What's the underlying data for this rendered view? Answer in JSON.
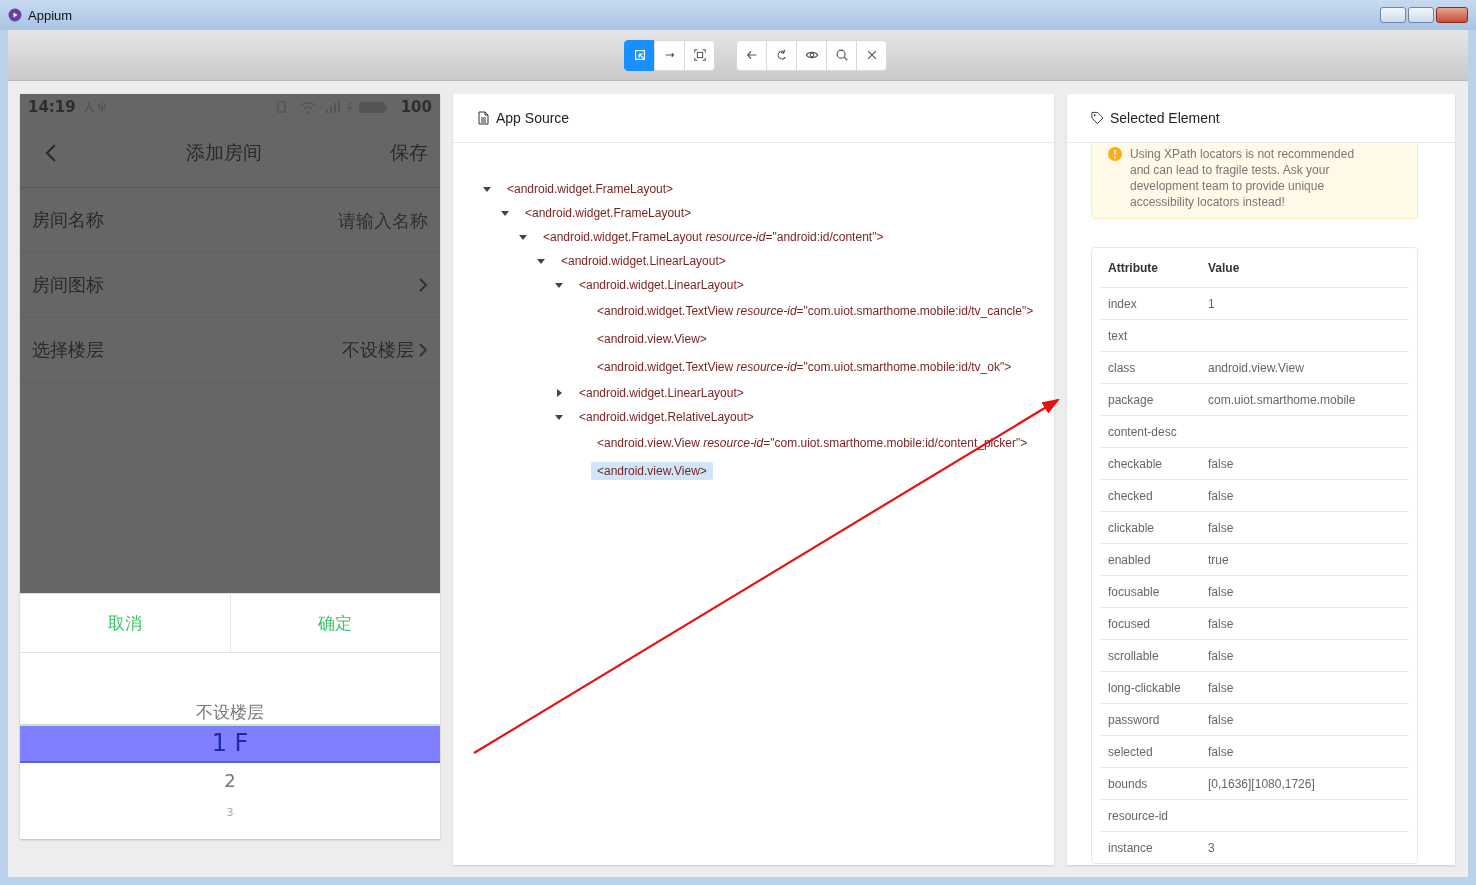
{
  "window": {
    "title": "Appium"
  },
  "toolbar": {
    "groups": [
      [
        {
          "kind": "inspect",
          "selected": true
        },
        {
          "kind": "swipe",
          "selected": false
        },
        {
          "kind": "tap",
          "selected": false
        }
      ],
      [
        {
          "kind": "back",
          "selected": false
        },
        {
          "kind": "refresh",
          "selected": false
        },
        {
          "kind": "eye",
          "selected": false
        },
        {
          "kind": "search",
          "selected": false
        },
        {
          "kind": "close",
          "selected": false
        }
      ]
    ]
  },
  "phone": {
    "status": {
      "time": "14:19",
      "battery": "100"
    },
    "header": {
      "title": "添加房间",
      "action": "保存"
    },
    "rows": [
      {
        "label": "房间名称",
        "placeholder": "请输入名称",
        "chevron": false
      },
      {
        "label": "房间图标",
        "chevron": true
      },
      {
        "label": "选择楼层",
        "value": "不设楼层",
        "chevron": true
      }
    ],
    "picker": {
      "cancel": "取消",
      "confirm": "确定",
      "options": [
        {
          "label": "不设楼层",
          "selected": false
        },
        {
          "label": "1 F",
          "selected": true
        },
        {
          "label": "2",
          "selected": false
        },
        {
          "label": "3",
          "selected": false
        }
      ]
    }
  },
  "source": {
    "title": "App Source",
    "nodes": [
      {
        "label": "<android.widget.FrameLayout>",
        "expanded": true,
        "selected": false,
        "children": [
          {
            "label": "<android.widget.FrameLayout>",
            "expanded": true,
            "selected": false,
            "children": [
              {
                "label": "<android.widget.FrameLayout *resource-id*=\"android:id/content\">",
                "expanded": true,
                "selected": false,
                "children": [
                  {
                    "label": "<android.widget.LinearLayout>",
                    "expanded": true,
                    "selected": false,
                    "children": [
                      {
                        "label": "<android.widget.LinearLayout>",
                        "expanded": true,
                        "selected": false,
                        "children": [
                          {
                            "label": "<android.widget.TextView *resource-id*=\"com.uiot.smarthome.mobile:id/tv_cancle\">",
                            "selected": false
                          },
                          {
                            "label": "<android.view.View>",
                            "selected": false
                          },
                          {
                            "label": "<android.widget.TextView *resource-id*=\"com.uiot.smarthome.mobile:id/tv_ok\">",
                            "selected": false
                          }
                        ]
                      },
                      {
                        "label": "<android.widget.LinearLayout>",
                        "expanded": false,
                        "selected": false
                      },
                      {
                        "label": "<android.widget.RelativeLayout>",
                        "expanded": true,
                        "selected": false,
                        "children": [
                          {
                            "label": "<android.view.View *resource-id*=\"com.uiot.smarthome.mobile:id/content_picker\">",
                            "selected": false
                          },
                          {
                            "label": "<android.view.View>",
                            "selected": true
                          }
                        ]
                      }
                    ]
                  }
                ]
              }
            ]
          }
        ]
      }
    ]
  },
  "selected_element": {
    "title": "Selected Element",
    "warning": "Using XPath locators is not recommended and can lead to fragile tests. Ask your development team to provide unique accessibility locators instead!",
    "columns": [
      "Attribute",
      "Value"
    ],
    "rows": [
      {
        "attribute": "index",
        "value": "1"
      },
      {
        "attribute": "text"
      },
      {
        "attribute": "class",
        "value": "android.view.View"
      },
      {
        "attribute": "package",
        "value": "com.uiot.smarthome.mobile"
      },
      {
        "attribute": "content-desc"
      },
      {
        "attribute": "checkable",
        "value": "false"
      },
      {
        "attribute": "checked",
        "value": "false"
      },
      {
        "attribute": "clickable",
        "value": "false"
      },
      {
        "attribute": "enabled",
        "value": "true"
      },
      {
        "attribute": "focusable",
        "value": "false"
      },
      {
        "attribute": "focused",
        "value": "false"
      },
      {
        "attribute": "scrollable",
        "value": "false"
      },
      {
        "attribute": "long-clickable",
        "value": "false"
      },
      {
        "attribute": "password",
        "value": "false"
      },
      {
        "attribute": "selected",
        "value": "false"
      },
      {
        "attribute": "bounds",
        "value": "[0,1636][1080,1726]"
      },
      {
        "attribute": "resource-id"
      },
      {
        "attribute": "instance",
        "value": "3"
      }
    ]
  }
}
